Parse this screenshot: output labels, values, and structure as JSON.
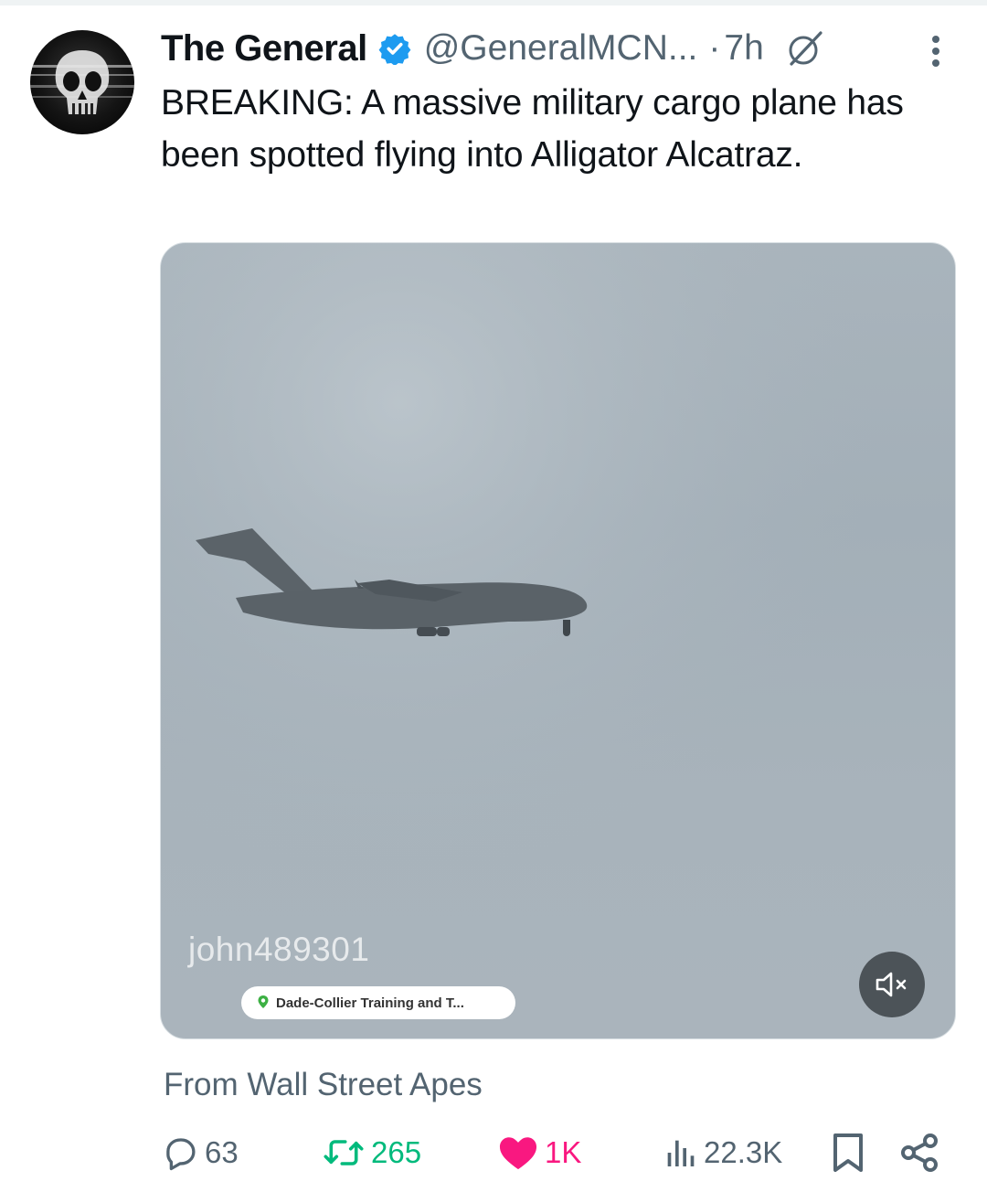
{
  "post": {
    "author_name": "The General",
    "handle": "@GeneralMCN...",
    "separator": "·",
    "time": "7h",
    "text": "BREAKING: A massive military cargo plane has been spotted flying into Alligator Alcatraz.",
    "media": {
      "watermark": "john489301",
      "location_tag": "Dade-Collier Training and T...",
      "mute_icon": "volume-muted-icon"
    },
    "source": "From Wall Street Apes",
    "actions": {
      "replies": "63",
      "reposts": "265",
      "likes": "1K",
      "views": "22.3K"
    }
  },
  "colors": {
    "text": "#0f1419",
    "secondary": "#536471",
    "verified": "#1d9bf0",
    "repost": "#00ba7c",
    "like": "#f91880"
  }
}
